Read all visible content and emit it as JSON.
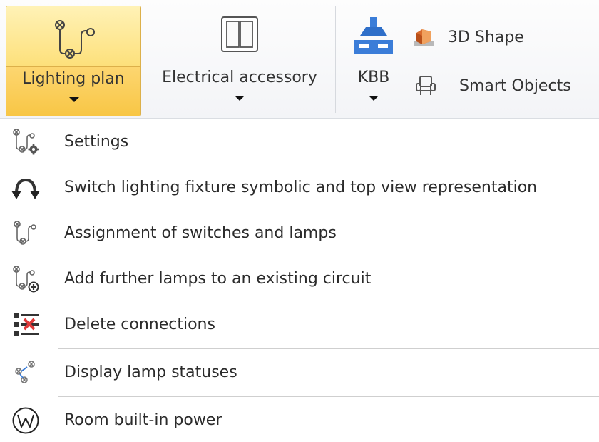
{
  "ribbon": {
    "lighting_plan": {
      "label": "Lighting plan",
      "icon": "lighting-circuit-icon",
      "state": "active"
    },
    "electrical_accessory": {
      "label": "Electrical accessory",
      "icon": "switch-panel-icon"
    },
    "kbb": {
      "label": "KBB",
      "icon": "kitchen-cabinet-icon"
    },
    "shape_3d": {
      "label": "3D Shape",
      "icon": "cube-icon"
    },
    "smart_objects": {
      "label": "Smart Objects",
      "icon": "armchair-icon"
    }
  },
  "menu": {
    "items": [
      {
        "label": "Settings",
        "icon": "lighting-settings-icon"
      },
      {
        "label": "Switch lighting fixture symbolic and top view representation",
        "icon": "switch-arrows-icon"
      },
      {
        "label": "Assignment of switches and lamps",
        "icon": "assign-lamp-icon"
      },
      {
        "label": "Add further lamps to an existing circuit",
        "icon": "add-lamp-icon"
      },
      {
        "label": "Delete connections",
        "icon": "delete-connections-icon"
      },
      {
        "label": "Display lamp statuses",
        "icon": "lamp-status-icon"
      },
      {
        "label": "Room built-in power",
        "icon": "power-circle-icon"
      }
    ]
  },
  "colors": {
    "active_button_top": "#fff2b6",
    "active_button_bottom": "#f8c645",
    "active_border": "#dcb04a",
    "accent_blue": "#3b7dd8",
    "delete_red": "#e03a3a"
  }
}
